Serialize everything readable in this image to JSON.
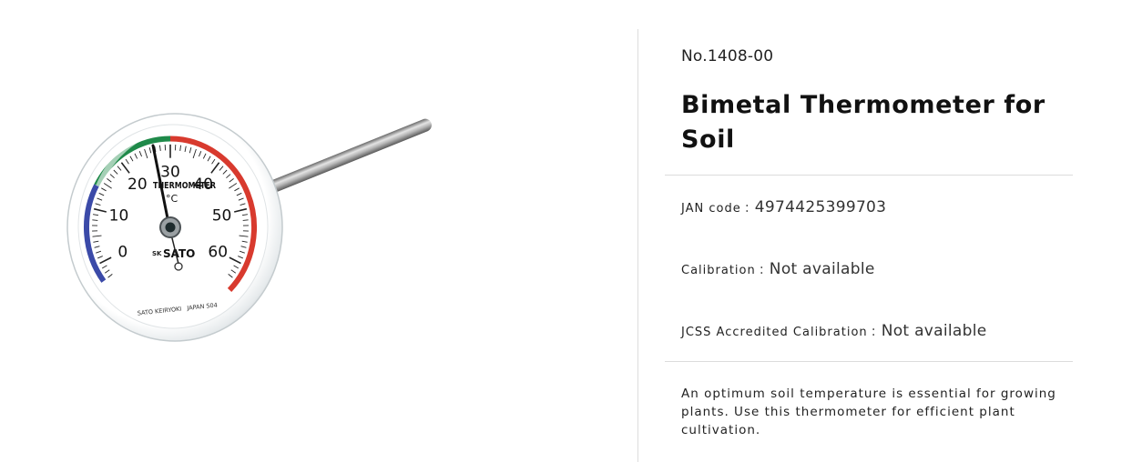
{
  "product": {
    "number": "No.1408-00",
    "title": "Bimetal Thermometer for Soil",
    "specs": [
      {
        "label": "JAN code",
        "separator": ":",
        "value": "4974425399703"
      },
      {
        "label": "Calibration",
        "separator": ":",
        "value": "Not available"
      },
      {
        "label": "JCSS Accredited Calibration",
        "separator": ":",
        "value": "Not available"
      }
    ],
    "description": "An optimum soil temperature is essential for growing plants. Use this thermometer for efficient plant cultivation."
  },
  "dial": {
    "brand": "SATO",
    "brand_mark": "SK",
    "face_label": "THERMOMETER",
    "unit": "°C",
    "maker_line": "SATO KEIRYOKI   JAPAN S04",
    "scale_labels": [
      "0",
      "10",
      "20",
      "30",
      "40",
      "50",
      "60"
    ],
    "zone_colors": {
      "cold": "#3b4aa8",
      "optimal": "#1f8a4a",
      "hot": "#d83a2e"
    }
  }
}
